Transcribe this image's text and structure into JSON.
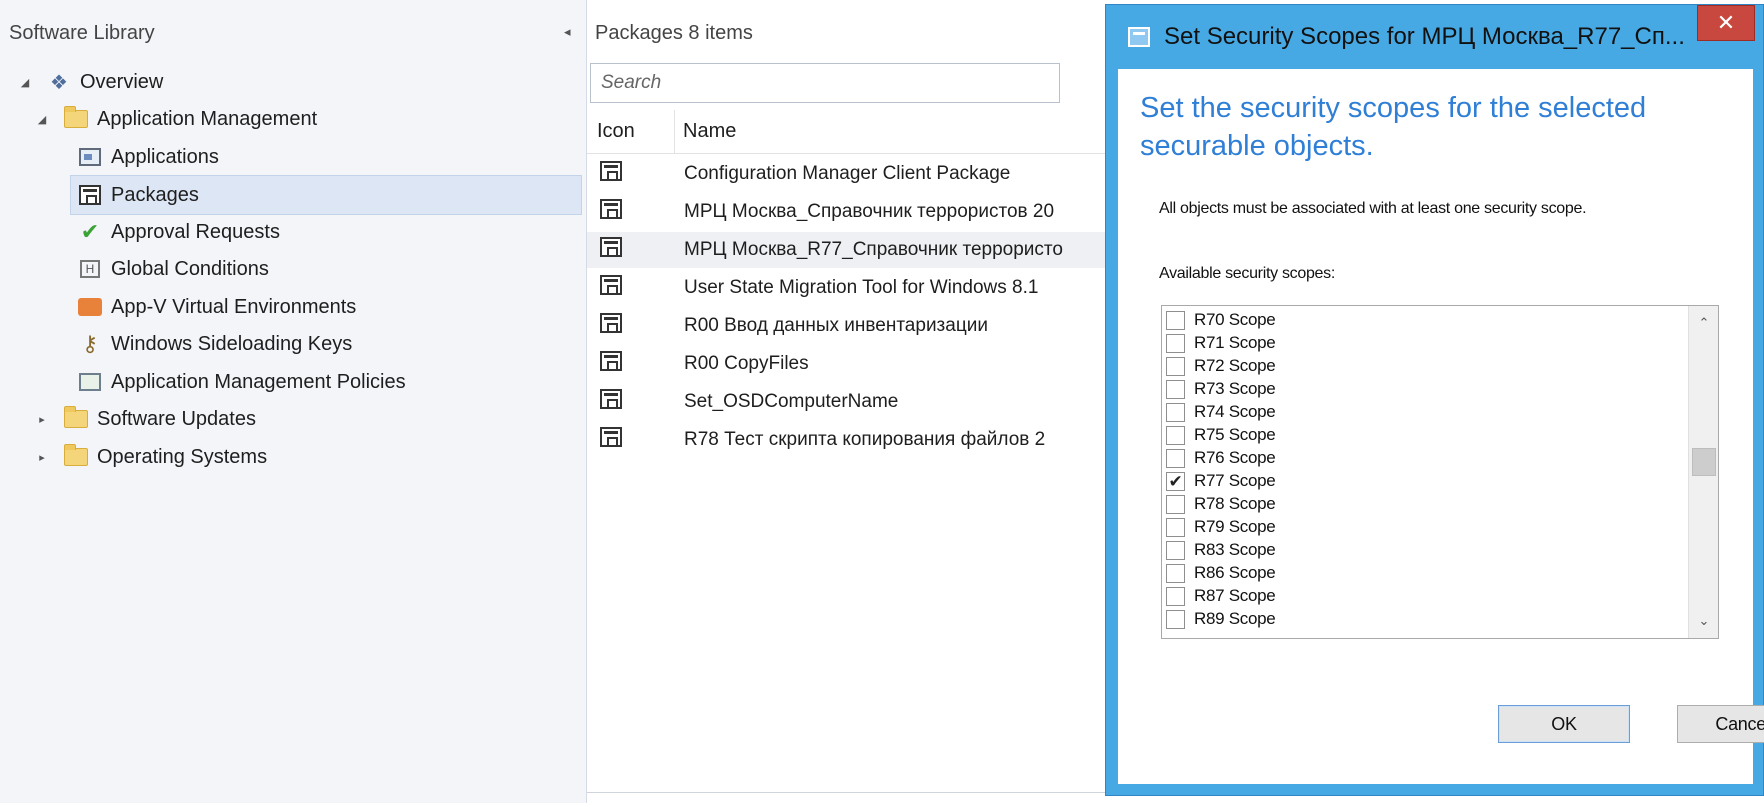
{
  "nav": {
    "header": "Software Library",
    "collapse_glyph": "◂",
    "items": [
      {
        "label": "Overview",
        "icon": "overview-icon",
        "expander": "◢"
      },
      {
        "label": "Application Management",
        "icon": "folder-icon",
        "expander": "◢"
      },
      {
        "label": "Applications",
        "icon": "applications-icon"
      },
      {
        "label": "Packages",
        "icon": "package-icon",
        "selected": true
      },
      {
        "label": "Approval Requests",
        "icon": "approval-check-icon"
      },
      {
        "label": "Global Conditions",
        "icon": "global-conditions-icon"
      },
      {
        "label": "App-V Virtual Environments",
        "icon": "appv-icon"
      },
      {
        "label": "Windows Sideloading Keys",
        "icon": "key-icon"
      },
      {
        "label": "Application Management Policies",
        "icon": "policy-icon"
      },
      {
        "label": "Software Updates",
        "icon": "folder-icon",
        "expander": "▸"
      },
      {
        "label": "Operating Systems",
        "icon": "folder-icon",
        "expander": "▸"
      }
    ]
  },
  "center": {
    "title": "Packages 8 items",
    "search_placeholder": "Search",
    "columns": {
      "icon": "Icon",
      "name": "Name"
    },
    "rows": [
      {
        "name": "Configuration Manager Client Package"
      },
      {
        "name": "МРЦ Москва_Справочник террористов 20"
      },
      {
        "name": "МРЦ Москва_R77_Справочник террористо",
        "selected": true
      },
      {
        "name": "User State Migration Tool for Windows 8.1"
      },
      {
        "name": "R00 Ввод данных инвентаризации"
      },
      {
        "name": "R00 CopyFiles"
      },
      {
        "name": "Set_OSDComputerName"
      },
      {
        "name": "R78 Тест скрипта копирования файлов 2"
      }
    ]
  },
  "dialog": {
    "title": "Set Security Scopes for МРЦ Москва_R77_Сп...",
    "close_glyph": "✕",
    "heading": "Set the security scopes for the selected securable objects.",
    "note": "All objects must be associated with at least one security scope.",
    "list_label": "Available security scopes:",
    "scopes": [
      {
        "label": "R70 Scope",
        "checked": false
      },
      {
        "label": "R71 Scope",
        "checked": false
      },
      {
        "label": "R72 Scope",
        "checked": false
      },
      {
        "label": "R73 Scope",
        "checked": false
      },
      {
        "label": "R74 Scope",
        "checked": false
      },
      {
        "label": "R75 Scope",
        "checked": false
      },
      {
        "label": "R76 Scope",
        "checked": false
      },
      {
        "label": "R77 Scope",
        "checked": true
      },
      {
        "label": "R78 Scope",
        "checked": false
      },
      {
        "label": "R79 Scope",
        "checked": false
      },
      {
        "label": "R83 Scope",
        "checked": false
      },
      {
        "label": "R86 Scope",
        "checked": false
      },
      {
        "label": "R87 Scope",
        "checked": false
      },
      {
        "label": "R89 Scope",
        "checked": false
      }
    ],
    "scroll_up_glyph": "⌃",
    "scroll_down_glyph": "⌄",
    "check_glyph": "✔",
    "ok_label": "OK",
    "cancel_label": "Cancel"
  },
  "colors": {
    "dialog_frame": "#47a9e3",
    "heading_blue": "#2f7fd6",
    "close_red": "#c8473e",
    "selection": "#dce6f4"
  }
}
